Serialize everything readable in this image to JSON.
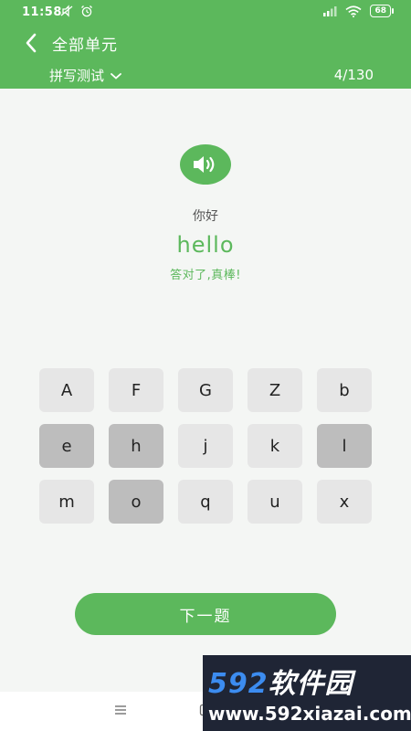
{
  "status_bar": {
    "time": "11:58",
    "battery": "68"
  },
  "header": {
    "title": "全部单元",
    "mode": "拼写测试",
    "progress": "4/130"
  },
  "question": {
    "meaning": "你好",
    "word": "hello",
    "feedback": "答对了,真棒!"
  },
  "keyboard": {
    "keys": [
      {
        "label": "A",
        "used": false
      },
      {
        "label": "F",
        "used": false
      },
      {
        "label": "G",
        "used": false
      },
      {
        "label": "Z",
        "used": false
      },
      {
        "label": "b",
        "used": false
      },
      {
        "label": "e",
        "used": true
      },
      {
        "label": "h",
        "used": true
      },
      {
        "label": "j",
        "used": false
      },
      {
        "label": "k",
        "used": false
      },
      {
        "label": "l",
        "used": true
      },
      {
        "label": "m",
        "used": false
      },
      {
        "label": "o",
        "used": true
      },
      {
        "label": "q",
        "used": false
      },
      {
        "label": "u",
        "used": false
      },
      {
        "label": "x",
        "used": false
      }
    ]
  },
  "actions": {
    "next_label": "下一题"
  },
  "watermark": {
    "brand_num": "592",
    "brand_text": "软件园",
    "url": "www.592xiazai.com"
  },
  "colors": {
    "accent": "#5cb85c",
    "key_default": "#e6e6e6",
    "key_used": "#bdbdbd"
  }
}
